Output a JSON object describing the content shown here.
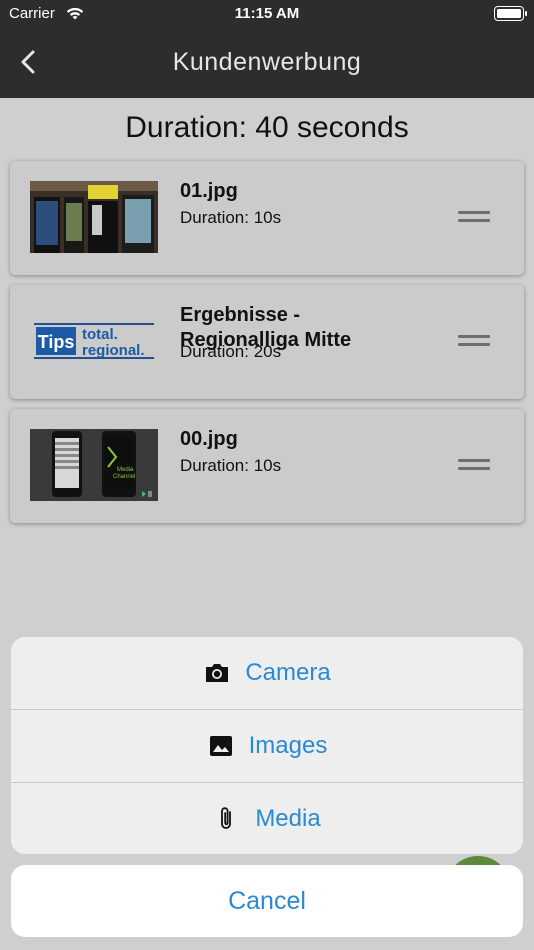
{
  "status_bar": {
    "carrier": "Carrier",
    "time": "11:15 AM"
  },
  "nav": {
    "title": "Kundenwerbung"
  },
  "playlist": {
    "total_duration": "Duration: 40 seconds",
    "items": [
      {
        "name": "01.jpg",
        "duration": "Duration: 10s"
      },
      {
        "name": "Ergebnisse - Regionalliga Mitte",
        "duration": "Duration: 20s",
        "thumb_text_1": "Tips",
        "thumb_text_2": "total.",
        "thumb_text_3": "regional."
      },
      {
        "name": "00.jpg",
        "duration": "Duration: 10s",
        "thumb_text_1": "Media",
        "thumb_text_2": "Channel"
      }
    ]
  },
  "action_sheet": {
    "options": [
      {
        "label": "Camera",
        "icon": "camera-icon"
      },
      {
        "label": "Images",
        "icon": "image-icon"
      },
      {
        "label": "Media",
        "icon": "paperclip-icon"
      }
    ],
    "cancel_label": "Cancel"
  },
  "colors": {
    "nav_bg": "#2b2e2d",
    "accent": "#2a89d4",
    "fab": "#5c8a3a"
  }
}
